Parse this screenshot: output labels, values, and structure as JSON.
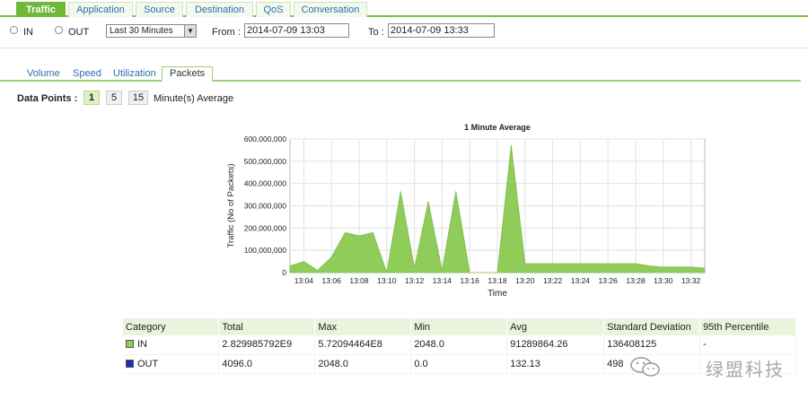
{
  "top_tabs": [
    {
      "label": "Traffic",
      "active": true
    },
    {
      "label": "Application",
      "active": false
    },
    {
      "label": "Source",
      "active": false
    },
    {
      "label": "Destination",
      "active": false
    },
    {
      "label": "QoS",
      "active": false
    },
    {
      "label": "Conversation",
      "active": false
    }
  ],
  "filter": {
    "in_label": "IN",
    "out_label": "OUT",
    "range_value": "Last 30 Minutes",
    "from_label": "From :",
    "from_value": "2014-07-09 13:03",
    "to_label": "To :",
    "to_value": "2014-07-09 13:33"
  },
  "sub_tabs": [
    {
      "label": "Volume",
      "active": false
    },
    {
      "label": "Speed",
      "active": false
    },
    {
      "label": "Utilization",
      "active": false
    },
    {
      "label": "Packets",
      "active": true
    }
  ],
  "data_points": {
    "label": "Data Points :",
    "options": [
      "1",
      "5",
      "15"
    ],
    "selected": "1",
    "suffix": "Minute(s) Average"
  },
  "chart_data": {
    "type": "area",
    "title": "1 Minute Average",
    "xlabel": "Time",
    "ylabel": "Traffic (No of Packets)",
    "ylim": [
      0,
      600000000
    ],
    "yticks": [
      "0",
      "100,000,000",
      "200,000,000",
      "300,000,000",
      "400,000,000",
      "500,000,000",
      "600,000,000"
    ],
    "xticks": [
      "13:04",
      "13:06",
      "13:08",
      "13:10",
      "13:12",
      "13:14",
      "13:16",
      "13:18",
      "13:20",
      "13:22",
      "13:24",
      "13:26",
      "13:28",
      "13:30",
      "13:32"
    ],
    "grid": true,
    "color": "#8fcc5a",
    "series": [
      {
        "name": "IN",
        "points": [
          [
            "13:03",
            30000000
          ],
          [
            "13:04",
            50000000
          ],
          [
            "13:05",
            10000000
          ],
          [
            "13:06",
            70000000
          ],
          [
            "13:07",
            180000000
          ],
          [
            "13:08",
            165000000
          ],
          [
            "13:09",
            180000000
          ],
          [
            "13:10",
            0
          ],
          [
            "13:11",
            365000000
          ],
          [
            "13:12",
            20000000
          ],
          [
            "13:13",
            320000000
          ],
          [
            "13:14",
            10000000
          ],
          [
            "13:15",
            365000000
          ],
          [
            "13:16",
            0
          ],
          [
            "13:18",
            0
          ],
          [
            "13:19",
            572000000
          ],
          [
            "13:20",
            40000000
          ],
          [
            "13:22",
            40000000
          ],
          [
            "13:24",
            40000000
          ],
          [
            "13:26",
            40000000
          ],
          [
            "13:28",
            40000000
          ],
          [
            "13:29",
            30000000
          ],
          [
            "13:30",
            25000000
          ],
          [
            "13:32",
            25000000
          ],
          [
            "13:33",
            20000000
          ]
        ]
      }
    ]
  },
  "stats_table": {
    "headers": [
      "Category",
      "Total",
      "Max",
      "Min",
      "Avg",
      "Standard Deviation",
      "95th Percentile"
    ],
    "rows": [
      {
        "category": "IN",
        "color": "#8fcc5a",
        "total": "2.829985792E9",
        "max": "5.72094464E8",
        "min": "2048.0",
        "avg": "91289864.26",
        "std": "136408125",
        "p95": "-"
      },
      {
        "category": "OUT",
        "color": "#1a2fb0",
        "total": "4096.0",
        "max": "2048.0",
        "min": "0.0",
        "avg": "132.13",
        "std": "498",
        "p95": ""
      }
    ]
  },
  "watermark": "绿盟科技"
}
